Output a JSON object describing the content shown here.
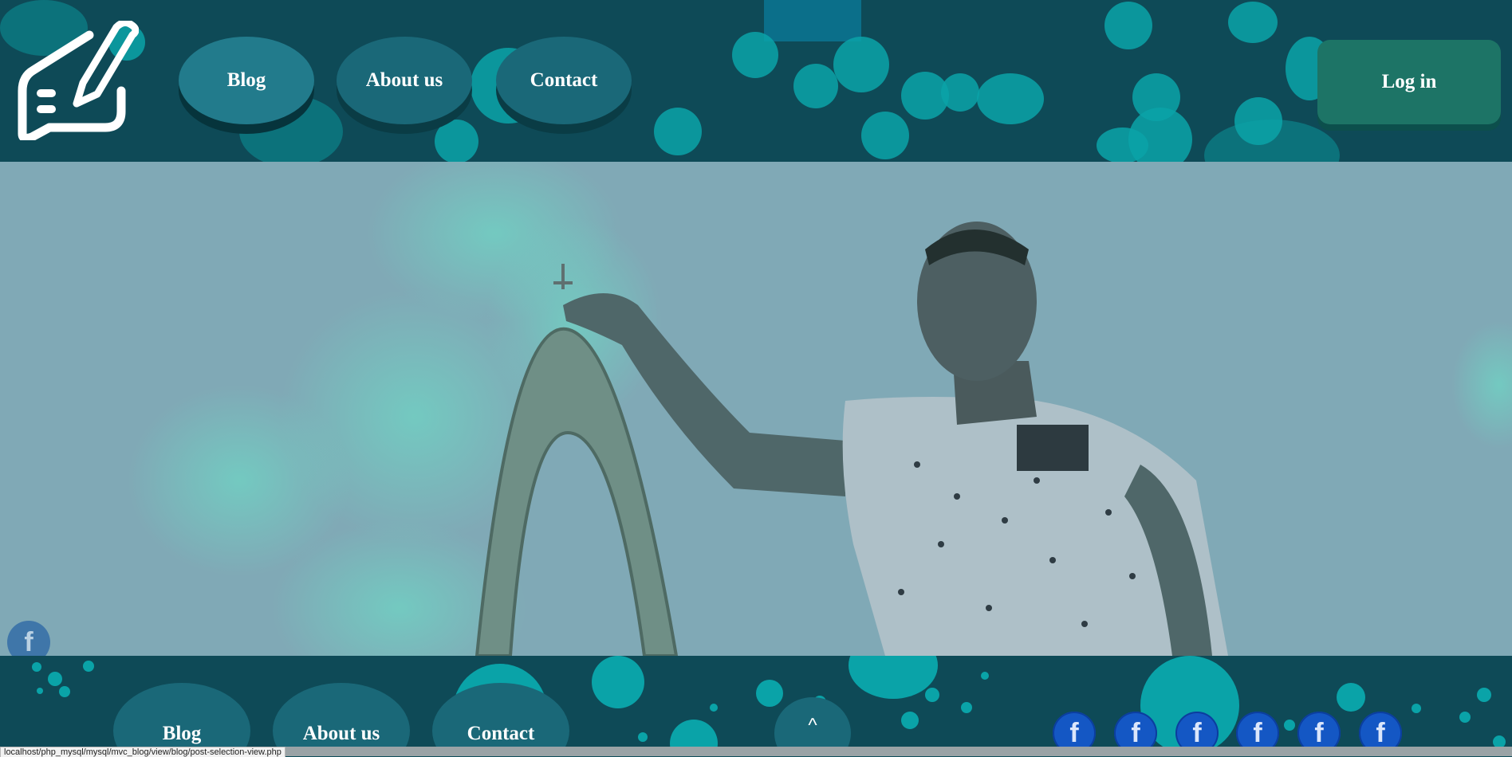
{
  "header": {
    "logo": "edit-note-icon",
    "nav": [
      "Blog",
      "About us",
      "Contact"
    ],
    "active_nav": "Blog",
    "login_label": "Log in"
  },
  "hero": {
    "image": "man-pointing-at-arch-photo",
    "floating_social": "facebook-icon",
    "floating_social_glyph": "f"
  },
  "footer": {
    "nav": [
      "Blog",
      "About us",
      "Contact"
    ],
    "back_to_top_label": "^",
    "social_icons": [
      "f",
      "f",
      "f",
      "f",
      "f",
      "f"
    ]
  },
  "status_bar": {
    "url": "localhost/php_mysql/mysql/mvc_blog/view/blog/post-selection-view.php"
  },
  "colors": {
    "header_bg": "#0e4a57",
    "accent_teal": "#0aa3a8",
    "nav_pill": "#1a6878",
    "login_bg": "#1d7466",
    "facebook_blue": "#1457c4"
  }
}
